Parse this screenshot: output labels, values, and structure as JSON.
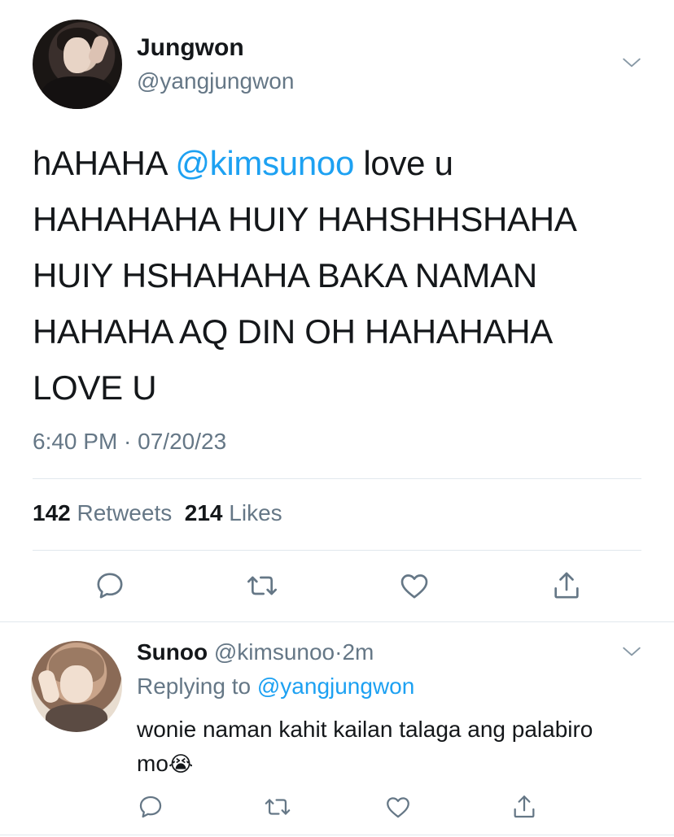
{
  "tweet": {
    "author_name": "Jungwon",
    "author_handle": "@yangjungwon",
    "text_before_mention": "hAHAHA ",
    "mention": "@kimsunoo",
    "text_after_mention": " love u\nHAHAHAHA HUIY HAHSHHSHAHA\nHUIY HSHAHAHA BAKA NAMAN\nHAHAHA AQ DIN OH HAHAHAHA\nLOVE U",
    "timestamp": "6:40 PM · 07/20/23",
    "retweets_count": "142",
    "retweets_label": "Retweets",
    "likes_count": "214",
    "likes_label": "Likes",
    "menu_icon": "chevron-down-icon",
    "actions": [
      "reply-icon",
      "retweet-icon",
      "like-icon",
      "share-icon"
    ]
  },
  "reply": {
    "author_name": "Sunoo",
    "author_handle": "@kimsunoo",
    "separator": "·",
    "time": "2m",
    "replying_label": "Replying to",
    "replying_to": "@yangjungwon",
    "text": "wonie naman kahit kailan talaga ang palabiro mo",
    "emoji": "😭",
    "menu_icon": "chevron-down-icon",
    "actions": [
      "reply-icon",
      "retweet-icon",
      "like-icon",
      "share-icon"
    ]
  },
  "colors": {
    "link": "#1da1f2",
    "secondary_text": "#657786",
    "primary_text": "#14171a",
    "divider": "#e1e8ed"
  }
}
